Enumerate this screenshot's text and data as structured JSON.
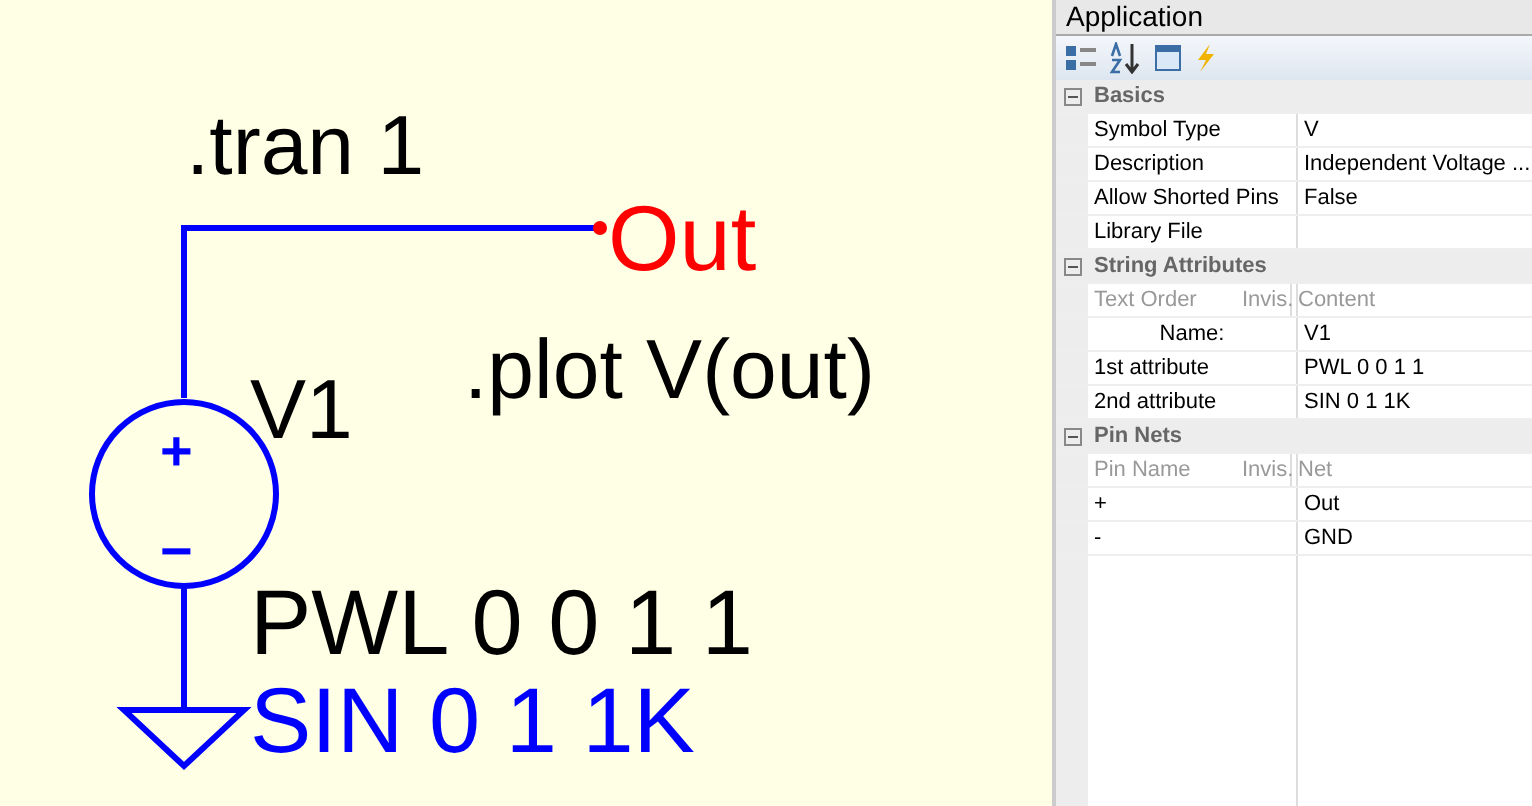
{
  "schematic": {
    "directives": [
      ".tran 1",
      ".plot V(out)"
    ],
    "net_label": "Out",
    "source": {
      "name": "V1",
      "plus": "+",
      "minus": "−",
      "attributes": [
        "PWL 0 0 1 1",
        "SIN 0 1 1K"
      ]
    }
  },
  "panel": {
    "dropdown": "Application",
    "rows": [
      {
        "kind": "section",
        "expanded": true,
        "label": "Basics"
      },
      {
        "kind": "prop",
        "name": "Symbol Type",
        "value": "V"
      },
      {
        "kind": "prop",
        "name": "Description",
        "value": "Independent Voltage ..."
      },
      {
        "kind": "prop",
        "name": "Allow Shorted Pins",
        "value": "False"
      },
      {
        "kind": "prop",
        "name": "Library File",
        "value": ""
      },
      {
        "kind": "section",
        "expanded": true,
        "label": "String Attributes"
      },
      {
        "kind": "header",
        "name": "Text Order",
        "invis": "Invis.",
        "value": "Content"
      },
      {
        "kind": "centered",
        "name": "Name:",
        "value": "V1"
      },
      {
        "kind": "prop",
        "name": "1st attribute",
        "value": "PWL 0 0 1 1"
      },
      {
        "kind": "prop",
        "name": "2nd attribute",
        "value": "SIN 0 1 1K"
      },
      {
        "kind": "section",
        "expanded": true,
        "label": "Pin Nets"
      },
      {
        "kind": "header",
        "name": "Pin Name",
        "invis": "Invis.",
        "value": "Net"
      },
      {
        "kind": "prop",
        "name": "+",
        "value": "Out"
      },
      {
        "kind": "prop",
        "name": "-",
        "value": "GND"
      }
    ]
  }
}
